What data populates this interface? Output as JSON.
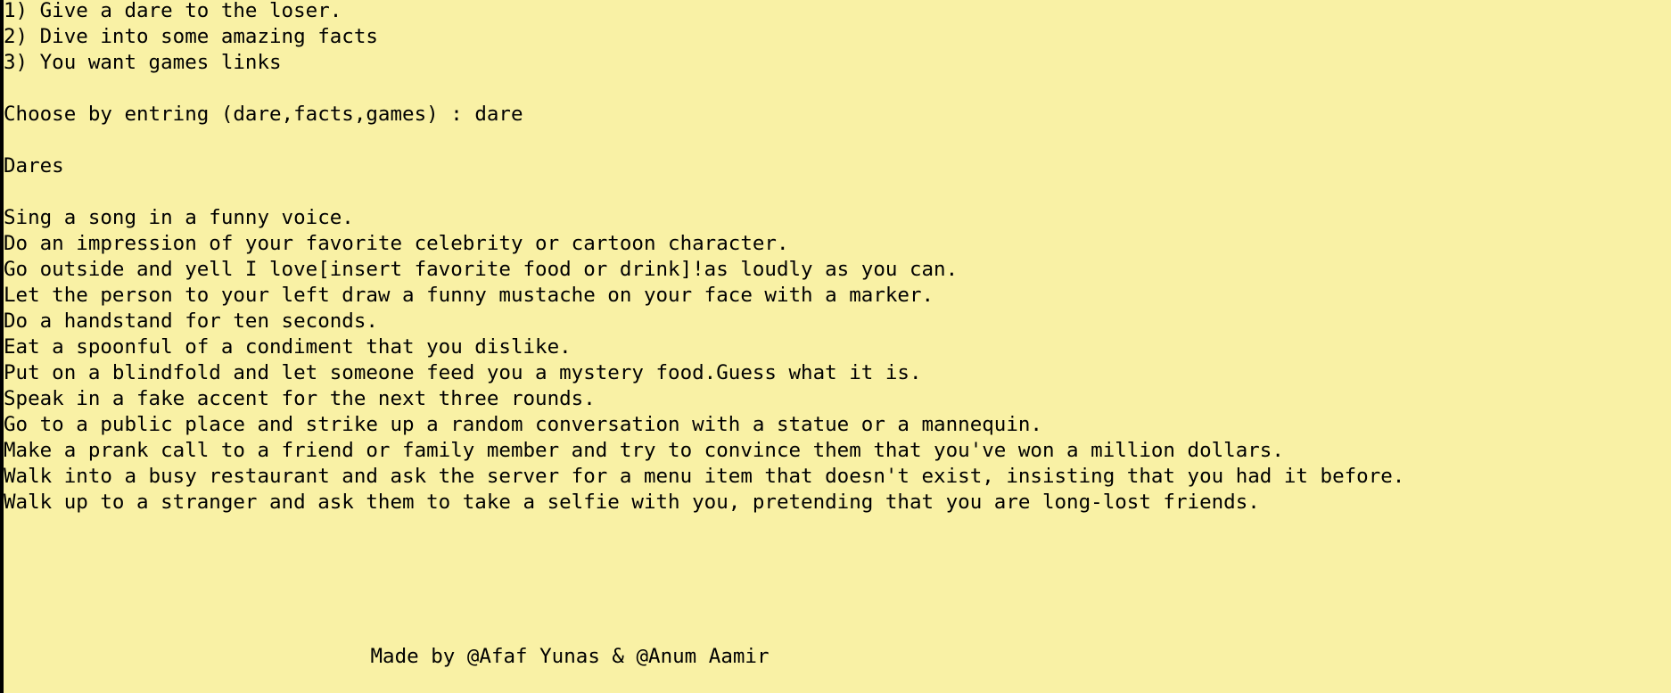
{
  "menu": {
    "options": [
      "1) Give a dare to the loser.",
      "2) Dive into some amazing facts",
      "3) You want games links"
    ]
  },
  "prompt": {
    "label": "Choose by entring (dare,facts,games) : ",
    "input_value": "dare"
  },
  "section": {
    "heading": "Dares"
  },
  "dares": [
    "Sing a song in a funny voice.",
    "Do an impression of your favorite celebrity or cartoon character.",
    "Go outside and yell I love[insert favorite food or drink]!as loudly as you can.",
    "Let the person to your left draw a funny mustache on your face with a marker.",
    "Do a handstand for ten seconds.",
    "Eat a spoonful of a condiment that you dislike.",
    "Put on a blindfold and let someone feed you a mystery food.Guess what it is.",
    "Speak in a fake accent for the next three rounds.",
    "Go to a public place and strike up a random conversation with a statue or a mannequin.",
    "Make a prank call to a friend or family member and try to convince them that you've won a million dollars.",
    "Walk into a busy restaurant and ask the server for a menu item that doesn't exist, insisting that you had it before.",
    "Walk up to a stranger and ask them to take a selfie with you, pretending that you are long-lost friends."
  ],
  "footer": {
    "credit": "Made by @Afaf Yunas & @Anum Aamir"
  }
}
